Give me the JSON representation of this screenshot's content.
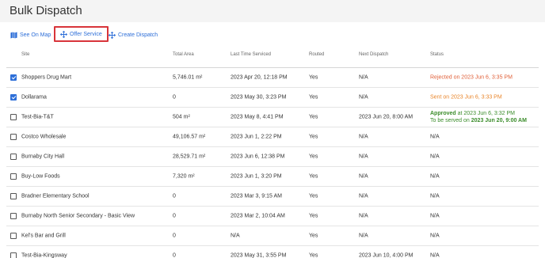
{
  "page": {
    "title": "Bulk Dispatch"
  },
  "toolbar": {
    "see_on_map": {
      "label": "See On Map",
      "icon": "map-icon"
    },
    "offer_service": {
      "label": "Offer Service",
      "icon": "offer-icon"
    },
    "create_dispatch": {
      "label": "Create Dispatch",
      "icon": "create-icon"
    },
    "accent": "#2e6fd8",
    "highlight": "#d8343a"
  },
  "table": {
    "columns": [
      "Site",
      "Total Area",
      "Last Time Serviced",
      "Routed",
      "Next Dispatch",
      "Status"
    ],
    "rows": [
      {
        "checked": true,
        "site": "Shoppers Drug Mart",
        "area": "5,746.01 m²",
        "last": "2023 Apr 20, 12:18 PM",
        "routed": "Yes",
        "next": "N/A",
        "status": "Rejected on 2023 Jun 6, 3:35 PM",
        "status_type": "rejected"
      },
      {
        "checked": true,
        "site": "Dollarama",
        "area": "0",
        "last": "2023 May 30, 3:23 PM",
        "routed": "Yes",
        "next": "N/A",
        "status": "Sent on 2023 Jun 6, 3:33 PM",
        "status_type": "sent"
      },
      {
        "checked": false,
        "site": "Test-Bia-T&T",
        "area": "504 m²",
        "last": "2023 May 8, 4:41 PM",
        "routed": "Yes",
        "next": "2023 Jun 20, 8:00 AM",
        "status": "",
        "status_type": "approved",
        "status_lines": {
          "l1_bold": "Approved",
          "l1_rest": " at 2023 Jun 6, 3:32 PM",
          "l2_rest": "To be served on ",
          "l2_bold": "2023 Jun 20, 9:00 AM"
        }
      },
      {
        "checked": false,
        "site": "Costco Wholesale",
        "area": "49,106.57 m²",
        "last": "2023 Jun 1, 2:22 PM",
        "routed": "Yes",
        "next": "N/A",
        "status": "N/A",
        "status_type": "none"
      },
      {
        "checked": false,
        "site": "Burnaby City Hall",
        "area": "28,529.71 m²",
        "last": "2023 Jun 6, 12:38 PM",
        "routed": "Yes",
        "next": "N/A",
        "status": "N/A",
        "status_type": "none"
      },
      {
        "checked": false,
        "site": "Buy-Low Foods",
        "area": "7,320 m²",
        "last": "2023 Jun 1, 3:20 PM",
        "routed": "Yes",
        "next": "N/A",
        "status": "N/A",
        "status_type": "none"
      },
      {
        "checked": false,
        "site": "Bradner Elementary School",
        "area": "0",
        "last": "2023 Mar 3, 9:15 AM",
        "routed": "Yes",
        "next": "N/A",
        "status": "N/A",
        "status_type": "none"
      },
      {
        "checked": false,
        "site": "Burnaby North Senior Secondary - Basic View",
        "area": "0",
        "last": "2023 Mar 2, 10:04 AM",
        "routed": "Yes",
        "next": "N/A",
        "status": "N/A",
        "status_type": "none"
      },
      {
        "checked": false,
        "site": "Kel's Bar and Grill",
        "area": "0",
        "last": "N/A",
        "routed": "Yes",
        "next": "N/A",
        "status": "N/A",
        "status_type": "none"
      },
      {
        "checked": false,
        "site": "Test-Bia-Kingsway",
        "area": "0",
        "last": "2023 May 31, 3:55 PM",
        "routed": "Yes",
        "next": "2023 Jun 10, 4:00 PM",
        "status": "N/A",
        "status_type": "none"
      }
    ]
  }
}
